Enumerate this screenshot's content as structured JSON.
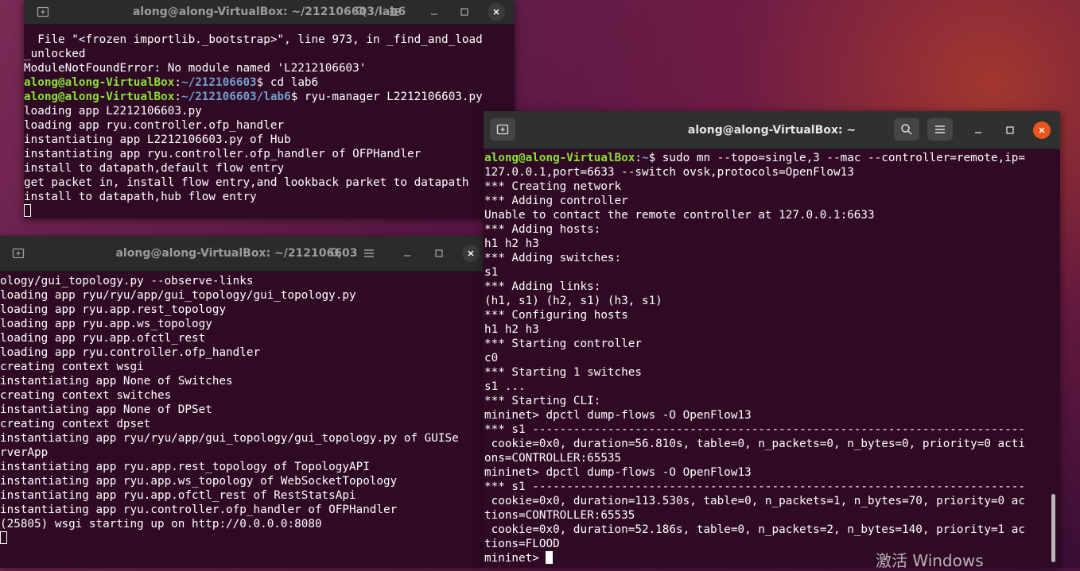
{
  "windows": [
    {
      "id": "w1",
      "title": "along@along-VirtualBox: ~/212106603/lab6",
      "lines": [
        [
          {
            "t": "  File \"<frozen importlib._bootstrap>\", line 973, in _find_and_load"
          }
        ],
        [
          {
            "t": "_unlocked"
          }
        ],
        [
          {
            "t": "ModuleNotFoundError: No module named 'L2212106603'"
          }
        ],
        [
          {
            "t": "along@along-VirtualBox",
            "c": "pu"
          },
          {
            "t": ":"
          },
          {
            "t": "~/212106603",
            "c": "pp"
          },
          {
            "t": "$ cd lab6"
          }
        ],
        [
          {
            "t": "along@along-VirtualBox",
            "c": "pu"
          },
          {
            "t": ":"
          },
          {
            "t": "~/212106603/lab6",
            "c": "pp"
          },
          {
            "t": "$ ryu-manager L2212106603.py"
          }
        ],
        [
          {
            "t": "loading app L2212106603.py"
          }
        ],
        [
          {
            "t": "loading app ryu.controller.ofp_handler"
          }
        ],
        [
          {
            "t": "instantiating app L2212106603.py of Hub"
          }
        ],
        [
          {
            "t": "instantiating app ryu.controller.ofp_handler of OFPHandler"
          }
        ],
        [
          {
            "t": "install to datapath,default flow entry"
          }
        ],
        [
          {
            "t": "get packet in, install flow entry,and lookback parket to datapath"
          }
        ],
        [
          {
            "t": "install to datapath,hub flow entry"
          }
        ],
        [
          {
            "cursor": "outline"
          }
        ]
      ]
    },
    {
      "id": "w2",
      "title": "along@along-VirtualBox: ~/212106603",
      "lines": [
        [
          {
            "t": "ology/gui_topology.py --observe-links"
          }
        ],
        [
          {
            "t": "loading app ryu/ryu/app/gui_topology/gui_topology.py"
          }
        ],
        [
          {
            "t": "loading app ryu.app.rest_topology"
          }
        ],
        [
          {
            "t": "loading app ryu.app.ws_topology"
          }
        ],
        [
          {
            "t": "loading app ryu.app.ofctl_rest"
          }
        ],
        [
          {
            "t": "loading app ryu.controller.ofp_handler"
          }
        ],
        [
          {
            "t": "creating context wsgi"
          }
        ],
        [
          {
            "t": "instantiating app None of Switches"
          }
        ],
        [
          {
            "t": "creating context switches"
          }
        ],
        [
          {
            "t": "instantiating app None of DPSet"
          }
        ],
        [
          {
            "t": "creating context dpset"
          }
        ],
        [
          {
            "t": "instantiating app ryu/ryu/app/gui_topology/gui_topology.py of GUISe"
          }
        ],
        [
          {
            "t": "rverApp"
          }
        ],
        [
          {
            "t": "instantiating app ryu.app.rest_topology of TopologyAPI"
          }
        ],
        [
          {
            "t": "instantiating app ryu.app.ws_topology of WebSocketTopology"
          }
        ],
        [
          {
            "t": "instantiating app ryu.app.ofctl_rest of RestStatsApi"
          }
        ],
        [
          {
            "t": "instantiating app ryu.controller.ofp_handler of OFPHandler"
          }
        ],
        [
          {
            "t": "(25805) wsgi starting up on http://0.0.0.0:8080"
          }
        ],
        [
          {
            "cursor": "outline"
          }
        ]
      ]
    },
    {
      "id": "w3",
      "title": "along@along-VirtualBox: ~",
      "lines": [
        [
          {
            "t": "along@along-VirtualBox",
            "c": "pu"
          },
          {
            "t": ":"
          },
          {
            "t": "~",
            "c": "pp"
          },
          {
            "t": "$ sudo mn --topo=single,3 --mac --controller=remote,ip="
          }
        ],
        [
          {
            "t": "127.0.0.1,port=6633 --switch ovsk,protocols=OpenFlow13"
          }
        ],
        [
          {
            "t": "*** Creating network"
          }
        ],
        [
          {
            "t": "*** Adding controller"
          }
        ],
        [
          {
            "t": "Unable to contact the remote controller at 127.0.0.1:6633"
          }
        ],
        [
          {
            "t": "*** Adding hosts:"
          }
        ],
        [
          {
            "t": "h1 h2 h3"
          }
        ],
        [
          {
            "t": "*** Adding switches:"
          }
        ],
        [
          {
            "t": "s1"
          }
        ],
        [
          {
            "t": "*** Adding links:"
          }
        ],
        [
          {
            "t": "(h1, s1) (h2, s1) (h3, s1)"
          }
        ],
        [
          {
            "t": "*** Configuring hosts"
          }
        ],
        [
          {
            "t": "h1 h2 h3"
          }
        ],
        [
          {
            "t": "*** Starting controller"
          }
        ],
        [
          {
            "t": "c0"
          }
        ],
        [
          {
            "t": "*** Starting 1 switches"
          }
        ],
        [
          {
            "t": "s1 ..."
          }
        ],
        [
          {
            "t": "*** Starting CLI:"
          }
        ],
        [
          {
            "t": "mininet> dpctl dump-flows -O OpenFlow13"
          }
        ],
        [
          {
            "t": "*** s1 ------------------------------------------------------------------------"
          }
        ],
        [
          {
            "t": " cookie=0x0, duration=56.810s, table=0, n_packets=0, n_bytes=0, priority=0 acti"
          }
        ],
        [
          {
            "t": "ons=CONTROLLER:65535"
          }
        ],
        [
          {
            "t": "mininet> dpctl dump-flows -O OpenFlow13"
          }
        ],
        [
          {
            "t": "*** s1 ------------------------------------------------------------------------"
          }
        ],
        [
          {
            "t": " cookie=0x0, duration=113.530s, table=0, n_packets=1, n_bytes=70, priority=0 ac"
          }
        ],
        [
          {
            "t": "tions=CONTROLLER:65535"
          }
        ],
        [
          {
            "t": " cookie=0x0, duration=52.186s, table=0, n_packets=2, n_bytes=140, priority=1 ac"
          }
        ],
        [
          {
            "t": "tions=FLOOD"
          }
        ],
        [
          {
            "t": "mininet> "
          },
          {
            "cursor": "filled"
          }
        ]
      ]
    }
  ],
  "watermark": "激活 Windows"
}
